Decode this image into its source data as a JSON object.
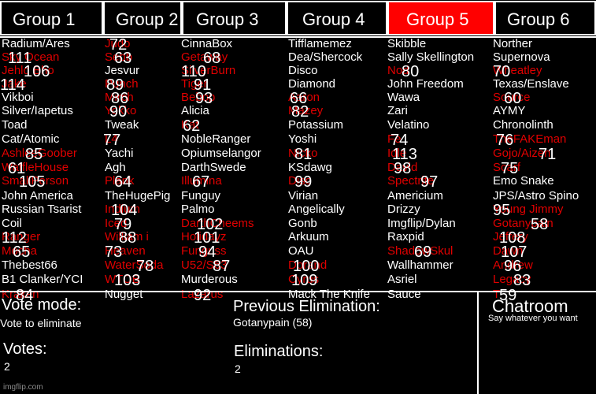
{
  "tabs": [
    {
      "label": "Group 1",
      "active": false
    },
    {
      "label": "Group 2",
      "active": false
    },
    {
      "label": "Group 3",
      "active": false
    },
    {
      "label": "Group 4",
      "active": false
    },
    {
      "label": "Group 5",
      "active": true
    },
    {
      "label": "Group 6",
      "active": false
    }
  ],
  "colors": {
    "background": "#000000",
    "text": "#ffffff",
    "eliminated": "#e00000",
    "active_tab": "#ff0000"
  },
  "groups": [
    {
      "members": [
        {
          "name": "Radium/Ares",
          "eliminated": false
        },
        {
          "name": "Sky Ocean",
          "eliminated": true,
          "placement": "111"
        },
        {
          "name": "Jehld Bho",
          "eliminated": true,
          "placement": "106"
        },
        {
          "name": "Jake",
          "eliminated": true,
          "placement": "114"
        },
        {
          "name": "Vikboi",
          "eliminated": false
        },
        {
          "name": "Silver/Iapetus",
          "eliminated": false
        },
        {
          "name": "Toad",
          "eliminated": false
        },
        {
          "name": "Cat/Atomic",
          "eliminated": false
        },
        {
          "name": "AshleeGoober",
          "eliminated": true,
          "placement": "85"
        },
        {
          "name": "WaffleHouse",
          "eliminated": true,
          "placement": "61"
        },
        {
          "name": "SmallPerson",
          "eliminated": true,
          "placement": "105"
        },
        {
          "name": "John America",
          "eliminated": false
        },
        {
          "name": "Russian Tsarist",
          "eliminated": false
        },
        {
          "name": "Coil",
          "eliminated": false
        },
        {
          "name": "Ranger",
          "eliminated": true,
          "placement": "112"
        },
        {
          "name": "Mocha",
          "eliminated": true,
          "placement": "65"
        },
        {
          "name": "Thebest66",
          "eliminated": false
        },
        {
          "name": "B1 Clanker/YCI",
          "eliminated": false
        },
        {
          "name": "Kraken",
          "eliminated": true,
          "placement": "84"
        }
      ]
    },
    {
      "members": [
        {
          "name": "Judo",
          "eliminated": true,
          "placement": "72"
        },
        {
          "name": "Sebb",
          "eliminated": true,
          "placement": "63"
        },
        {
          "name": "Jesvur",
          "eliminated": false
        },
        {
          "name": "Punch",
          "eliminated": true,
          "placement": "89"
        },
        {
          "name": "Mirch",
          "eliminated": true,
          "placement": "86"
        },
        {
          "name": "Yokko",
          "eliminated": true,
          "placement": "90"
        },
        {
          "name": "Tweak",
          "eliminated": false
        },
        {
          "name": "L4",
          "eliminated": true,
          "placement": "77"
        },
        {
          "name": "Yachi",
          "eliminated": false
        },
        {
          "name": "Agh",
          "eliminated": false
        },
        {
          "name": "Plank",
          "eliminated": true,
          "placement": "64"
        },
        {
          "name": "TheHugePig",
          "eliminated": false
        },
        {
          "name": "Indium",
          "eliminated": true,
          "placement": "104"
        },
        {
          "name": "Iced",
          "eliminated": true,
          "placement": "79"
        },
        {
          "name": "William i",
          "eliminated": true,
          "placement": "88"
        },
        {
          "name": "Heaven",
          "eliminated": true,
          "placement": "73"
        },
        {
          "name": "WaterSoda",
          "eliminated": true,
          "placement": "78"
        },
        {
          "name": "WTOB",
          "eliminated": true,
          "placement": "103"
        },
        {
          "name": "Nugget",
          "eliminated": false
        }
      ]
    },
    {
      "members": [
        {
          "name": "CinnaBox",
          "eliminated": false
        },
        {
          "name": "Getaway",
          "eliminated": true,
          "placement": "68"
        },
        {
          "name": "SilverBurn",
          "eliminated": true,
          "placement": "110"
        },
        {
          "name": "Tiger",
          "eliminated": true,
          "placement": "91"
        },
        {
          "name": "Bebop",
          "eliminated": true,
          "placement": "93"
        },
        {
          "name": "Alicia",
          "eliminated": false
        },
        {
          "name": "Kat",
          "eliminated": true,
          "placement": "62"
        },
        {
          "name": "NobleRanger",
          "eliminated": false
        },
        {
          "name": "Opiumselangor",
          "eliminated": false
        },
        {
          "name": "DarthSwede",
          "eliminated": false
        },
        {
          "name": "Illumina",
          "eliminated": true,
          "placement": "67"
        },
        {
          "name": "Funguy",
          "eliminated": false
        },
        {
          "name": "Palmo",
          "eliminated": false
        },
        {
          "name": "DarthCheems",
          "eliminated": true,
          "placement": "102"
        },
        {
          "name": "Holidayz",
          "eliminated": true,
          "placement": "101"
        },
        {
          "name": "Funguss",
          "eliminated": true,
          "placement": "94"
        },
        {
          "name": "U52/S63",
          "eliminated": true,
          "placement": "87"
        },
        {
          "name": "Murderous",
          "eliminated": false
        },
        {
          "name": "Lazarus",
          "eliminated": true,
          "placement": "92"
        }
      ]
    },
    {
      "members": [
        {
          "name": "Tifflamemez",
          "eliminated": false
        },
        {
          "name": "Dea/Shercock",
          "eliminated": false
        },
        {
          "name": "Disco",
          "eliminated": false
        },
        {
          "name": "Diamond",
          "eliminated": false
        },
        {
          "name": "Aaron",
          "eliminated": true,
          "placement": "66"
        },
        {
          "name": "Mazey",
          "eliminated": true,
          "placement": "82"
        },
        {
          "name": "Potassium",
          "eliminated": false
        },
        {
          "name": "Yoshi",
          "eliminated": false
        },
        {
          "name": "Nicko",
          "eliminated": true,
          "placement": "81"
        },
        {
          "name": "KSdawg",
          "eliminated": false
        },
        {
          "name": "Disc",
          "eliminated": true,
          "placement": "99"
        },
        {
          "name": "Virian",
          "eliminated": false
        },
        {
          "name": "Angelically",
          "eliminated": false
        },
        {
          "name": "Gonb",
          "eliminated": false
        },
        {
          "name": "Arkuum",
          "eliminated": false
        },
        {
          "name": "OAU",
          "eliminated": false
        },
        {
          "name": "Dorand",
          "eliminated": true,
          "placement": "100"
        },
        {
          "name": "Cyrus",
          "eliminated": true,
          "placement": "109"
        },
        {
          "name": "Mack The Knife",
          "eliminated": false
        }
      ]
    },
    {
      "members": [
        {
          "name": "Skibble",
          "eliminated": false
        },
        {
          "name": "Sally Skellington",
          "eliminated": false
        },
        {
          "name": "Nod",
          "eliminated": true,
          "placement": "80"
        },
        {
          "name": "John Freedom",
          "eliminated": false
        },
        {
          "name": "Wawa",
          "eliminated": false
        },
        {
          "name": "Zari",
          "eliminated": false
        },
        {
          "name": "Velatino",
          "eliminated": false
        },
        {
          "name": "Fe",
          "eliminated": true,
          "placement": "74"
        },
        {
          "name": "Idle",
          "eliminated": true,
          "placement": "113"
        },
        {
          "name": "David",
          "eliminated": true,
          "placement": "98"
        },
        {
          "name": "Spectrite",
          "eliminated": true,
          "placement": "97"
        },
        {
          "name": "Americium",
          "eliminated": false
        },
        {
          "name": "Drizzy",
          "eliminated": false
        },
        {
          "name": "Imgflip/Dylan",
          "eliminated": false
        },
        {
          "name": "Raxpid",
          "eliminated": false
        },
        {
          "name": "ShadowSkul",
          "eliminated": true,
          "placement": "69"
        },
        {
          "name": "Wallhammer",
          "eliminated": false
        },
        {
          "name": "Asriel",
          "eliminated": false
        },
        {
          "name": "Sauce",
          "eliminated": false
        }
      ]
    },
    {
      "members": [
        {
          "name": "Norther",
          "eliminated": false
        },
        {
          "name": "Supernova",
          "eliminated": false
        },
        {
          "name": "Wheatley",
          "eliminated": true,
          "placement": "70"
        },
        {
          "name": "Texas/Enslave",
          "eliminated": false
        },
        {
          "name": "Source",
          "eliminated": true,
          "placement": "60"
        },
        {
          "name": "AYMY",
          "eliminated": false
        },
        {
          "name": "Chronolinth",
          "eliminated": false
        },
        {
          "name": "TheFAKEman",
          "eliminated": true,
          "placement": "76"
        },
        {
          "name": "Gojo/Aizen",
          "eliminated": true,
          "placement": "71"
        },
        {
          "name": "Scarf",
          "eliminated": true,
          "placement": "75"
        },
        {
          "name": "Emo Snake",
          "eliminated": false
        },
        {
          "name": "JPS/Astro Spino",
          "eliminated": false
        },
        {
          "name": "Young Jimmy",
          "eliminated": true,
          "placement": "95"
        },
        {
          "name": "Gotanypain",
          "eliminated": true,
          "placement": "58"
        },
        {
          "name": "Jeffery",
          "eliminated": true,
          "placement": "108"
        },
        {
          "name": "Dawn",
          "eliminated": true,
          "placement": "107"
        },
        {
          "name": "Andrew",
          "eliminated": true,
          "placement": "96"
        },
        {
          "name": "Legacy",
          "eliminated": true,
          "placement": "83"
        },
        {
          "name": "T",
          "eliminated": true,
          "placement": "59"
        }
      ]
    }
  ],
  "footer": {
    "vote_mode_label": "Vote mode:",
    "vote_mode_value": "Vote to eliminate",
    "votes_label": "Votes:",
    "votes_value": "2",
    "prev_elim_label": "Previous Elimination:",
    "prev_elim_value": "Gotanypain (58)",
    "eliminations_label": "Eliminations:",
    "eliminations_value": "2",
    "chatroom_label": "Chatroom",
    "chatroom_sub": "Say whatever you want",
    "watermark": "imgflip.com"
  }
}
